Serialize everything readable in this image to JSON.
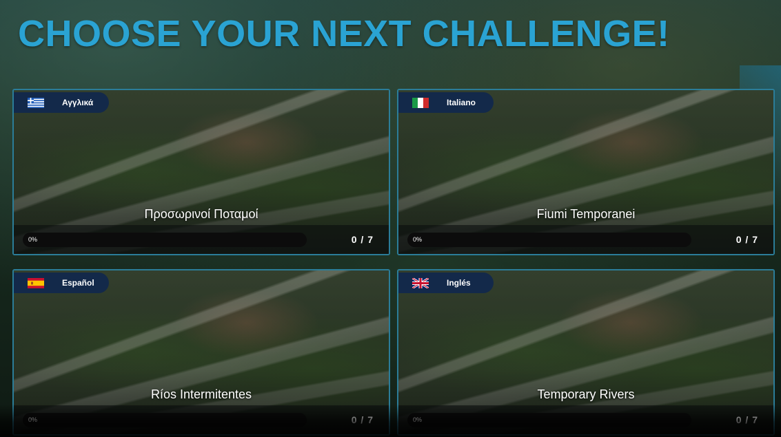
{
  "page": {
    "title": "CHOOSE YOUR NEXT CHALLENGE!",
    "accent_color": "#2aa3d3",
    "card_border_color": "#2b7d99",
    "pill_color": "#13294a"
  },
  "cards": [
    {
      "language": "Αγγλικά",
      "flag": "greece-flag-icon",
      "name": "Προσωρινοί Ποταμοί",
      "progress_label": "0%",
      "progress": 0,
      "count": "0 / 7"
    },
    {
      "language": "Italiano",
      "flag": "italy-flag-icon",
      "name": "Fiumi Temporanei",
      "progress_label": "0%",
      "progress": 0,
      "count": "0 / 7"
    },
    {
      "language": "Español",
      "flag": "spain-flag-icon",
      "name": "Ríos Intermitentes",
      "progress_label": "0%",
      "progress": 0,
      "count": "0 / 7"
    },
    {
      "language": "Inglés",
      "flag": "uk-flag-icon",
      "name": "Temporary Rivers",
      "progress_label": "0%",
      "progress": 0,
      "count": "0 / 7"
    }
  ]
}
